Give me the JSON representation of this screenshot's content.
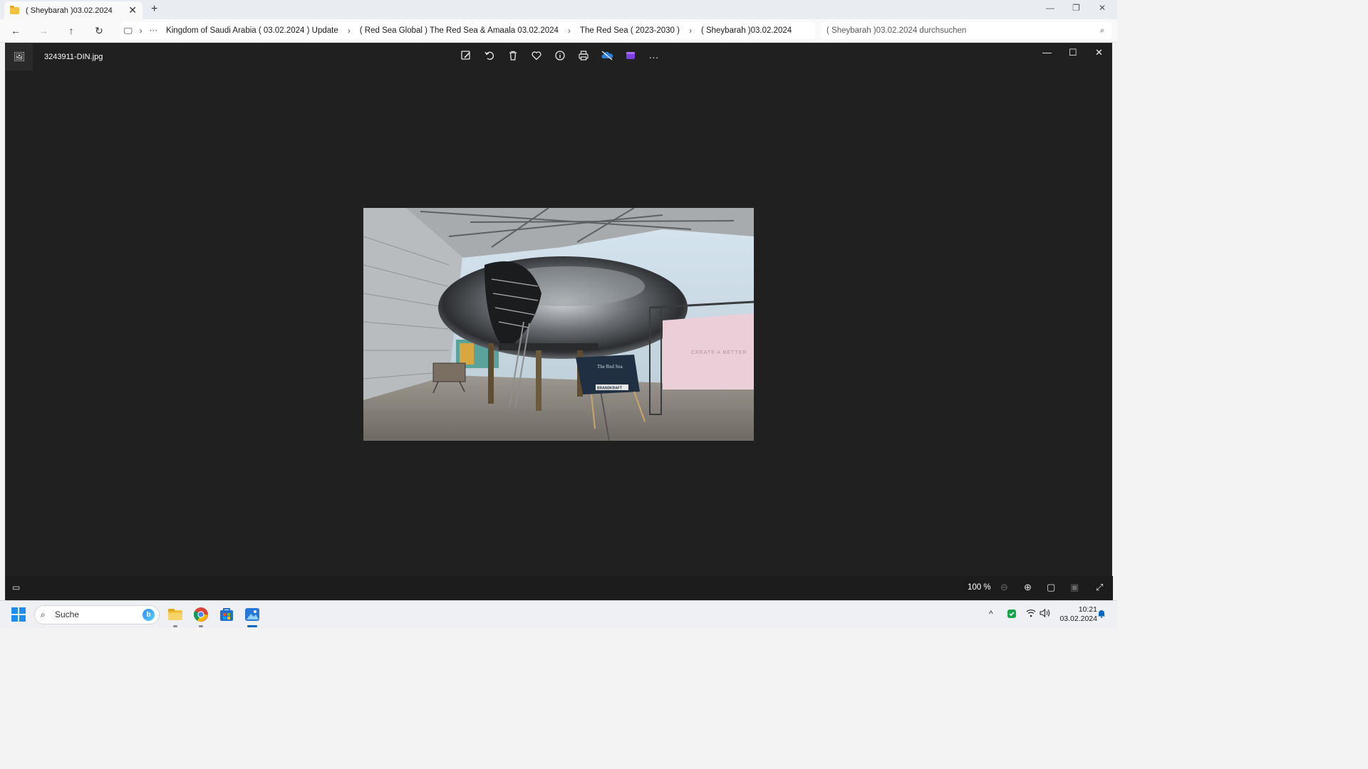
{
  "explorer": {
    "tab_title": "( Sheybarah )03.02.2024",
    "tab_close": "✕",
    "new_tab": "+",
    "window_controls": {
      "minimize": "—",
      "restore": "❐",
      "close": "✕"
    },
    "nav": {
      "back": "←",
      "forward": "→",
      "up": "↑",
      "refresh": "↻",
      "pc": "🖵",
      "chevron": "›",
      "more": "···"
    },
    "breadcrumbs": [
      "Kingdom of Saudi Arabia ( 03.02.2024 ) Update",
      "( Red Sea Global ) The Red Sea & Amaala 03.02.2024",
      "The Red Sea ( 2023-2030 )",
      "( Sheybarah )03.02.2024"
    ],
    "search_placeholder": "( Sheybarah )03.02.2024 durchsuchen"
  },
  "viewer": {
    "filename": "3243911-DIN.jpg",
    "toolbar_icons": [
      "edit-icon",
      "rotate-icon",
      "trash-icon",
      "heart-icon",
      "info-icon",
      "print-icon",
      "onedrive-icon",
      "clipchamp-icon",
      "more-icon"
    ],
    "window_controls": {
      "minimize": "—",
      "maximize": "☐",
      "close": "✕"
    },
    "zoom_level": "100 %",
    "photo_sign_text": "CREATE A BETTER",
    "photo_board_title": "The Red Sea",
    "photo_board_brand": "BRANDKRAFT"
  },
  "taskbar": {
    "search_label": "Suche",
    "time": "10:21",
    "date": "03.02.2024",
    "accent": "#0067c0"
  }
}
